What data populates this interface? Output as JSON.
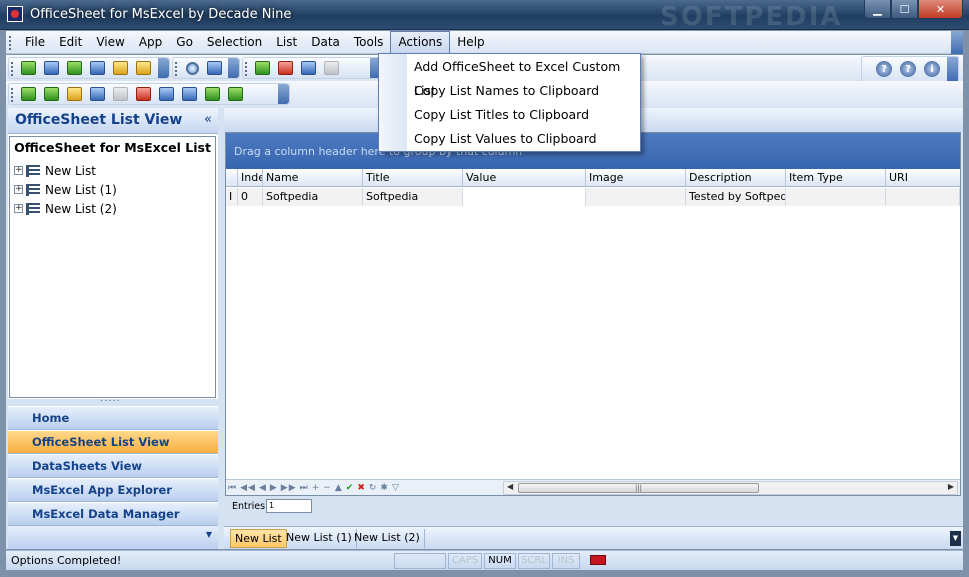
{
  "window": {
    "title": "OfficeSheet for MsExcel by Decade Nine",
    "watermark": "SOFTPEDIA"
  },
  "menu": {
    "items": [
      "File",
      "Edit",
      "View",
      "App",
      "Go",
      "Selection",
      "List",
      "Data",
      "Tools",
      "Actions",
      "Help"
    ],
    "active": "Actions"
  },
  "actions_menu": {
    "items": [
      "Add OfficeSheet to Excel Custom List",
      "Copy List Names to Clipboard",
      "Copy List Titles to Clipboard",
      "Copy List Values to Clipboard"
    ]
  },
  "left_panel": {
    "title": "OfficeSheet List View",
    "collapse_glyph": "«",
    "tree_header": "OfficeSheet for MsExcel List",
    "tree_items": [
      "New List",
      "New List (1)",
      "New List (2)"
    ],
    "nav_buttons": [
      "Home",
      "OfficeSheet List View",
      "DataSheets View",
      "MsExcel App Explorer",
      "MsExcel Data Manager"
    ],
    "selected_nav": "OfficeSheet List View"
  },
  "grid": {
    "group_hint": "Drag a column header here to group by that column",
    "columns": [
      "",
      "Index",
      "Name",
      "Title",
      "Value",
      "Image",
      "Description",
      "Item Type",
      "URI"
    ],
    "rows": [
      {
        "marker": "I",
        "index": "0",
        "name": "Softpedia",
        "title": "Softpedia",
        "value": "",
        "image": "",
        "description": "Tested by Softpedia",
        "item_type": "",
        "uri": ""
      }
    ],
    "entries_label": "Entries:",
    "entries_value": "1"
  },
  "tabs": {
    "items": [
      "New List",
      "New List (1)",
      "New List (2)"
    ],
    "active": "New List"
  },
  "status": {
    "message": "Options Completed!",
    "panels": [
      {
        "label": "CAPS",
        "on": false
      },
      {
        "label": "NUM",
        "on": true
      },
      {
        "label": "SCRL",
        "on": false
      },
      {
        "label": "INS",
        "on": false
      }
    ]
  },
  "icons": {
    "toolbar1": [
      "open-icon",
      "save-icon",
      "export-icon",
      "refresh-icon",
      "undo-icon",
      "folder-icon"
    ],
    "toolbar2": [
      "find-icon",
      "find-replace-icon"
    ],
    "toolbar3": [
      "add-row-icon",
      "delete-row-icon",
      "insert-icon",
      "disabled-icon"
    ],
    "help": [
      "help-icon",
      "about-icon",
      "info-icon"
    ]
  }
}
